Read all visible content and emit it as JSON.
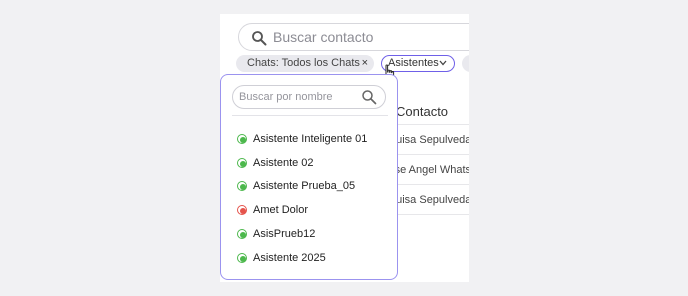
{
  "search": {
    "placeholder": "Buscar contacto"
  },
  "filters": {
    "chats_chip": "Chats: Todos los Chats",
    "chats_chip_remove": "×",
    "assistants_chip": "Asistentes"
  },
  "contacts_table": {
    "header": "Contacto",
    "rows": [
      "Luisa Sepulveda",
      "Jose Angel Whats",
      "Luisa Sepulveda"
    ]
  },
  "assistant_dropdown": {
    "search_placeholder": "Buscar por nombre",
    "items": [
      {
        "label": "Asistente Inteligente 01",
        "status": "active"
      },
      {
        "label": "Asistente 02",
        "status": "active"
      },
      {
        "label": "Asistente Prueba_05",
        "status": "active"
      },
      {
        "label": "Amet Dolor",
        "status": "inactive"
      },
      {
        "label": "AsisPrueb12",
        "status": "active"
      },
      {
        "label": "Asistente 2025",
        "status": "active"
      }
    ]
  },
  "colors": {
    "accent": "#6f60e8",
    "active": "#4cb84c",
    "inactive": "#e5534b"
  }
}
